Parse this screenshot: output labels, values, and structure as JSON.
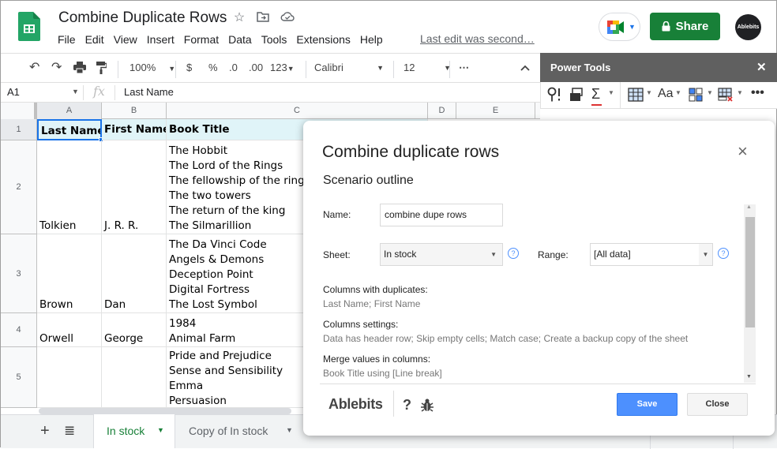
{
  "app": {
    "title": "Combine Duplicate Rows",
    "menu": [
      "File",
      "Edit",
      "View",
      "Insert",
      "Format",
      "Data",
      "Tools",
      "Extensions",
      "Help"
    ],
    "last_edit": "Last edit was second…",
    "share_label": "Share",
    "avatar_text": "Ablebits"
  },
  "toolbar": {
    "zoom": "100%",
    "currency": "$",
    "percent": "%",
    "dec_decrease": ".0",
    "dec_increase": ".00",
    "number_format": "123",
    "font": "Calibri",
    "font_size": "12",
    "more": "⋯"
  },
  "formula_bar": {
    "cell_ref": "A1",
    "fx": "fx",
    "value": "Last Name"
  },
  "grid": {
    "columns": [
      "A",
      "B",
      "C",
      "D",
      "E"
    ],
    "rows": [
      {
        "num": "1",
        "a": "Last Name",
        "b": "First Name",
        "c": [
          "Book Title"
        ]
      },
      {
        "num": "2",
        "a": "Tolkien",
        "b": "J. R. R.",
        "c": [
          "The Hobbit",
          "The Lord of the Rings",
          "The fellowship of the ring",
          "The two towers",
          "The return of the king",
          "The Silmarillion"
        ]
      },
      {
        "num": "3",
        "a": "Brown",
        "b": "Dan",
        "c": [
          "The Da Vinci Code",
          "Angels & Demons",
          "Deception Point",
          "Digital Fortress",
          "The Lost Symbol"
        ]
      },
      {
        "num": "4",
        "a": "Orwell",
        "b": "George",
        "c": [
          "1984",
          "Animal Farm"
        ]
      },
      {
        "num": "5",
        "a": "",
        "b": "",
        "c": [
          "Pride and Prejudice",
          "Sense and Sensibility",
          "Emma",
          "Persuasion"
        ]
      }
    ]
  },
  "sheet_tabs": {
    "add": "+",
    "list": "≣",
    "tabs": [
      {
        "label": "In stock",
        "active": true
      },
      {
        "label": "Copy of In stock",
        "active": false
      }
    ]
  },
  "power_tools": {
    "title": "Power Tools",
    "close": "✕"
  },
  "dialog": {
    "title": "Combine duplicate rows",
    "subtitle": "Scenario outline",
    "close": "×",
    "name_label": "Name:",
    "name_value": "combine dupe rows",
    "sheet_label": "Sheet:",
    "sheet_value": "In stock",
    "range_label": "Range:",
    "range_value": "[All data]",
    "help": "?",
    "sections": [
      {
        "label": "Columns with duplicates:",
        "value": "Last Name; First Name"
      },
      {
        "label": "Columns settings:",
        "value": "Data has header row; Skip empty cells; Match case; Create a backup copy of the sheet"
      },
      {
        "label": "Merge values in columns:",
        "value": "Book Title using [Line break]"
      }
    ],
    "brand": "Ablebits",
    "help_footer": "?",
    "save_label": "Save",
    "close_label": "Close"
  },
  "colors": {
    "share_green": "#188038",
    "save_blue": "#4d90fe",
    "header_fill": "#e0f4f8",
    "tab_active": "#188038",
    "powertools_header": "#606060"
  }
}
